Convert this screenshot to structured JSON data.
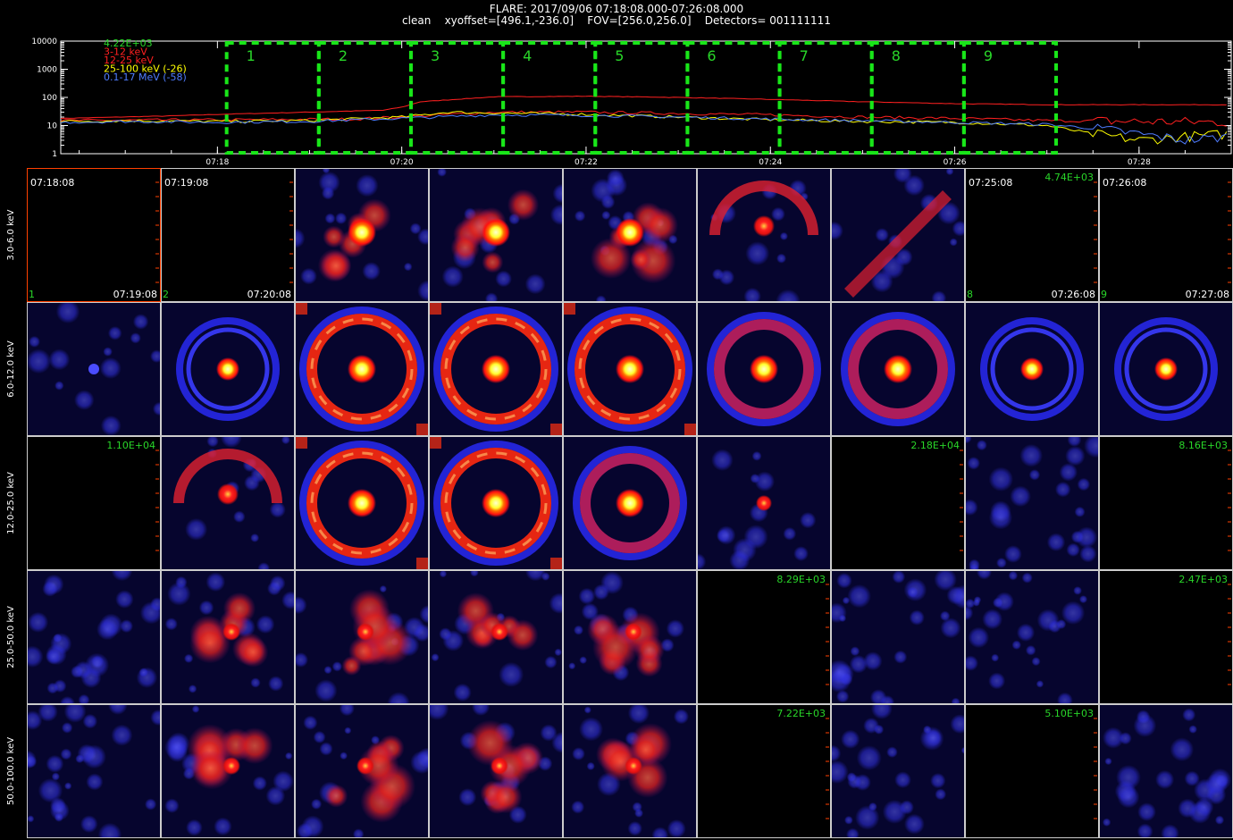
{
  "header": {
    "line1": "FLARE: 2017/09/06 07:18:08.000-07:26:08.000",
    "line2": "clean    xyoffset=[496.1,-236.0]    FOV=[256.0,256.0]    Detectors= 001111111"
  },
  "chart_data": [
    {
      "type": "line",
      "title": "",
      "yscale": "log",
      "ylim": [
        1,
        10000
      ],
      "y_ticks": [
        "10000",
        "1000",
        "100",
        "10",
        "1"
      ],
      "x_ticks": [
        "07:18",
        "07:20",
        "07:22",
        "07:24",
        "07:26",
        "07:28"
      ],
      "x_tick_minutes": [
        18,
        20,
        22,
        24,
        26,
        28
      ],
      "xlim_minutes": [
        16.3,
        29.0
      ],
      "legend_placement": "top-left",
      "legend_top": "4.22E+03",
      "series": [
        {
          "name": "3-12 keV",
          "color": "#ff2020",
          "x": [
            16.3,
            17.5,
            18.0,
            19.0,
            19.8,
            20.0,
            20.2,
            21.0,
            22.0,
            23.0,
            24.0,
            25.0,
            26.0,
            27.0,
            28.0,
            29.0
          ],
          "y": [
            18,
            22,
            25,
            30,
            35,
            45,
            70,
            105,
            110,
            100,
            85,
            70,
            60,
            55,
            55,
            55
          ]
        },
        {
          "name": "12-25 keV",
          "color": "#ff2020",
          "x": [
            16.3,
            18.0,
            19.5,
            20.2,
            21.0,
            22.0,
            23.0,
            24.0,
            25.0,
            26.0,
            27.0,
            28.0,
            29.0
          ],
          "y": [
            15,
            16,
            17,
            22,
            30,
            30,
            27,
            24,
            20,
            18,
            15,
            14,
            13
          ]
        },
        {
          "name": "25-100 keV (-26)",
          "color": "#ffff00",
          "x": [
            16.3,
            17.0,
            18.0,
            19.0,
            20.0,
            20.5,
            21.0,
            22.0,
            23.0,
            24.0,
            25.0,
            26.0,
            27.0,
            27.5,
            28.0,
            28.5,
            29.0
          ],
          "y": [
            14,
            15,
            14,
            15,
            20,
            30,
            28,
            25,
            20,
            16,
            14,
            13,
            10,
            5,
            3,
            4,
            5
          ]
        },
        {
          "name": "0.1-17 MeV (-58)",
          "color": "#4f7cff",
          "x": [
            16.3,
            17.0,
            18.0,
            19.0,
            20.0,
            21.0,
            22.0,
            23.0,
            24.0,
            25.0,
            26.0,
            27.0,
            27.5,
            28.0,
            28.5,
            29.0
          ],
          "y": [
            13,
            14,
            13,
            14,
            18,
            24,
            23,
            20,
            17,
            15,
            13,
            11,
            8,
            5,
            3,
            4
          ]
        }
      ],
      "intervals": [
        "1",
        "2",
        "3",
        "4",
        "5",
        "6",
        "7",
        "8",
        "9"
      ],
      "interval_start_minutes": [
        18.1,
        19.1,
        20.1,
        21.1,
        22.1,
        23.1,
        24.1,
        25.1,
        26.1,
        27.1
      ]
    },
    {
      "type": "heatmap",
      "rows": [
        "3.0-6.0 keV",
        "6.0-12.0 keV",
        "12.0-25.0 keV",
        "25.0-50.0 keV",
        "50.0-100.0 keV"
      ],
      "columns": [
        "1",
        "2",
        "3",
        "4",
        "5",
        "6",
        "7",
        "8",
        "9"
      ],
      "row_time_labels": {
        "start": [
          "07:18:08",
          "07:19:08",
          "",
          "",
          "",
          "",
          "",
          "07:25:08",
          "07:26:08"
        ],
        "end": [
          "07:19:08",
          "07:20:08",
          "",
          "",
          "",
          "",
          "",
          "07:26:08",
          "07:27:08"
        ]
      },
      "blank_panels": [
        {
          "row": 0,
          "col": 0,
          "label": ""
        },
        {
          "row": 0,
          "col": 1,
          "label": ""
        },
        {
          "row": 0,
          "col": 7,
          "label": "4.74E+03"
        },
        {
          "row": 0,
          "col": 8,
          "label": ""
        },
        {
          "row": 2,
          "col": 0,
          "label": "1.10E+04"
        },
        {
          "row": 2,
          "col": 6,
          "label": "2.18E+04"
        },
        {
          "row": 2,
          "col": 8,
          "label": "8.16E+03"
        },
        {
          "row": 3,
          "col": 5,
          "label": "8.29E+03"
        },
        {
          "row": 3,
          "col": 8,
          "label": "2.47E+03"
        },
        {
          "row": 4,
          "col": 5,
          "label": "7.22E+03"
        },
        {
          "row": 4,
          "col": 7,
          "label": "5.10E+03"
        }
      ],
      "panel_types": [
        [
          "blank",
          "blank",
          "blob",
          "blob",
          "blob",
          "arc",
          "diag",
          "blank",
          "blank"
        ],
        [
          "faint",
          "ring_small",
          "ring_big",
          "ring_big",
          "ring_big",
          "ring_mid",
          "ring_mid",
          "ring_small",
          "ring_small"
        ],
        [
          "blank",
          "arc",
          "ring_big",
          "ring_big",
          "ring_mid",
          "faint_src",
          "blank",
          "noise",
          "blank"
        ],
        [
          "noise",
          "blob",
          "blob",
          "blob",
          "blob",
          "blank",
          "noise",
          "noise",
          "blank"
        ],
        [
          "noise",
          "blob",
          "blob",
          "blob",
          "blob",
          "blank",
          "noise",
          "blank",
          "noise"
        ]
      ],
      "colors": {
        "background": "#06052e",
        "frame": "#ff4000",
        "low": "#2a2cff",
        "mid": "#ff2020",
        "high": "#ffff60"
      }
    }
  ]
}
